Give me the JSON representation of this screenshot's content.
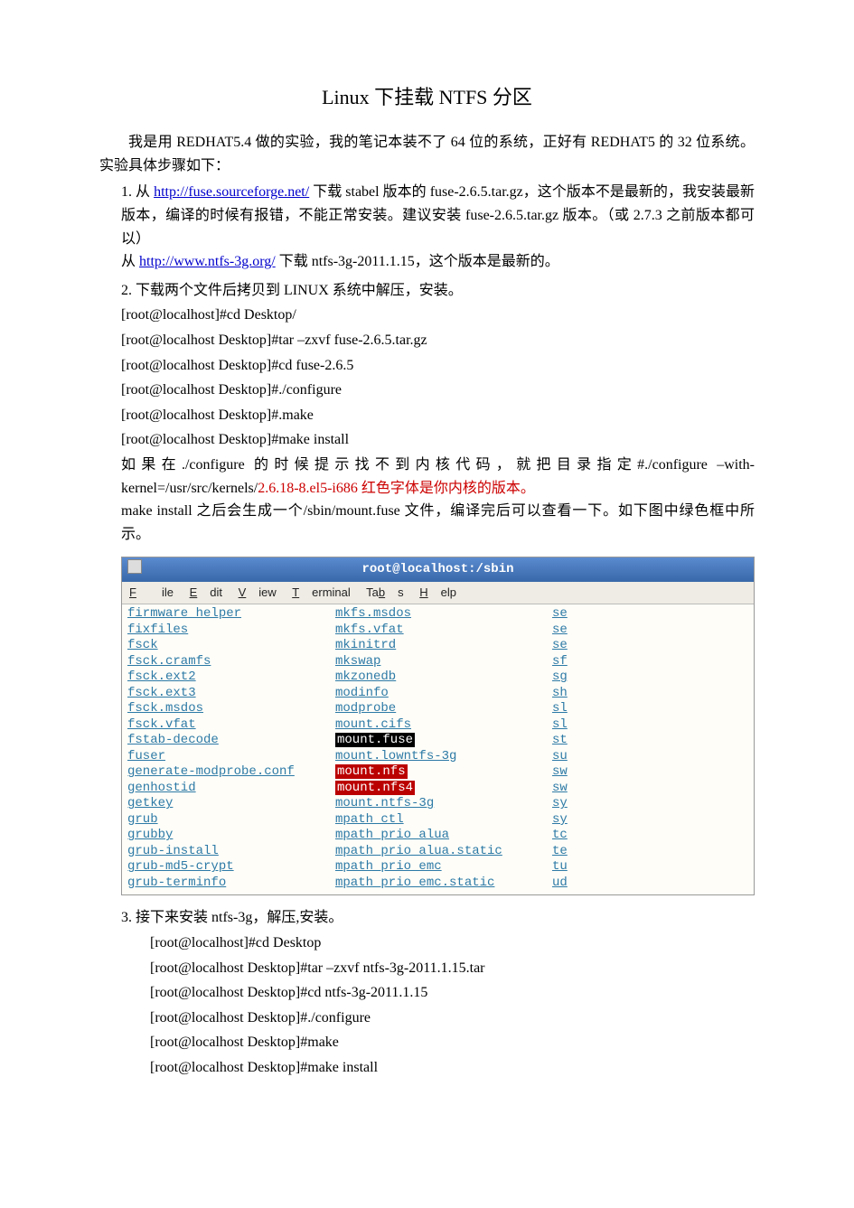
{
  "title": "Linux 下挂载 NTFS 分区",
  "intro": "我是用 REDHAT5.4 做的实验，我的笔记本装不了 64 位的系统，正好有 REDHAT5 的 32 位系统。实验具体步骤如下：",
  "step1": {
    "num": "1.",
    "t1": "从",
    "link1": "http://fuse.sourceforge.net/",
    "t2": "下载 stabel 版本的 fuse-2.6.5.tar.gz，这个版本不是最新的，我安装最新版本，编译的时候有报错，不能正常安装。建议安装 fuse-2.6.5.tar.gz 版本。（或 2.7.3 之前版本都可以）",
    "t3": "从",
    "link2": "http://www.ntfs-3g.org/",
    "t4": "下载 ntfs-3g-2011.1.15，这个版本是最新的。"
  },
  "step2": {
    "num": "2.",
    "t1": "下载两个文件后拷贝到 LINUX 系统中解压，安装。",
    "cmd1": "[root@localhost]#cd  Desktop/",
    "cmd2": "[root@localhost  Desktop]#tar  –zxvf  fuse-2.6.5.tar.gz",
    "cmd3": "[root@localhost  Desktop]#cd  fuse-2.6.5",
    "cmd4": "[root@localhost  Desktop]#./configure",
    "cmd5": "[root@localhost  Desktop]#.make",
    "cmd6": "[root@localhost  Desktop]#make  install",
    "t2a": "如果在./configure 的时候提示找不到内核代码，就把目录指定#./configure –with-kernel=/usr/src/kernels/",
    "t2red": "2.6.18-8.el5-i686 红色字体是你内核的版本。",
    "t3": "make  install 之后会生成一个/sbin/mount.fuse 文件，编译完后可以查看一下。如下图中绿色框中所示。"
  },
  "terminal": {
    "title": "root@localhost:/sbin",
    "menu": [
      "File",
      "Edit",
      "View",
      "Terminal",
      "Tabs",
      "Help"
    ],
    "rows": [
      {
        "c1": "firmware_helper",
        "c2": "mkfs.msdos",
        "c3": "se"
      },
      {
        "c1": "fixfiles",
        "c2": "mkfs.vfat",
        "c3": "se"
      },
      {
        "c1": "fsck",
        "c2": "mkinitrd",
        "c3": "se"
      },
      {
        "c1": "fsck.cramfs",
        "c2": "mkswap",
        "c3": "sf"
      },
      {
        "c1": "fsck.ext2",
        "c2": "mkzonedb",
        "c3": "sg"
      },
      {
        "c1": "fsck.ext3",
        "c2": "modinfo",
        "c3": "sh"
      },
      {
        "c1": "fsck.msdos",
        "c2": "modprobe",
        "c3": "sl"
      },
      {
        "c1": "fsck.vfat",
        "c2": "mount.cifs",
        "c3": "sl"
      },
      {
        "c1": "fstab-decode",
        "c2": "mount.fuse",
        "c2_hl": "black",
        "c3": "st"
      },
      {
        "c1": "fuser",
        "c2": "mount.lowntfs-3g",
        "c3": "su"
      },
      {
        "c1": "generate-modprobe.conf",
        "c2": "mount.nfs",
        "c2_hl": "red",
        "c3": "sw"
      },
      {
        "c1": "genhostid",
        "c2": "mount.nfs4",
        "c2_hl": "red",
        "c3": "sw"
      },
      {
        "c1": "getkey",
        "c2": "mount.ntfs-3g",
        "c3": "sy"
      },
      {
        "c1": "grub",
        "c2": "mpath_ctl",
        "c3": "sy"
      },
      {
        "c1": "grubby",
        "c2": "mpath_prio_alua",
        "c3": "tc"
      },
      {
        "c1": "grub-install",
        "c2": "mpath_prio_alua.static",
        "c3": "te"
      },
      {
        "c1": "grub-md5-crypt",
        "c2": "mpath_prio_emc",
        "c3": "tu"
      },
      {
        "c1": "grub-terminfo",
        "c2": "mpath_prio_emc.static",
        "c3": "ud"
      }
    ]
  },
  "step3": {
    "num": "3.",
    "t1": "接下来安装 ntfs-3g，解压,安装。",
    "cmd1": "[root@localhost]#cd  Desktop",
    "cmd2": "[root@localhost  Desktop]#tar  –zxvf  ntfs-3g-2011.1.15.tar",
    "cmd3": "[root@localhost  Desktop]#cd  ntfs-3g-2011.1.15",
    "cmd4": "[root@localhost  Desktop]#./configure",
    "cmd5": "[root@localhost  Desktop]#make",
    "cmd6": "[root@localhost  Desktop]#make  install"
  }
}
